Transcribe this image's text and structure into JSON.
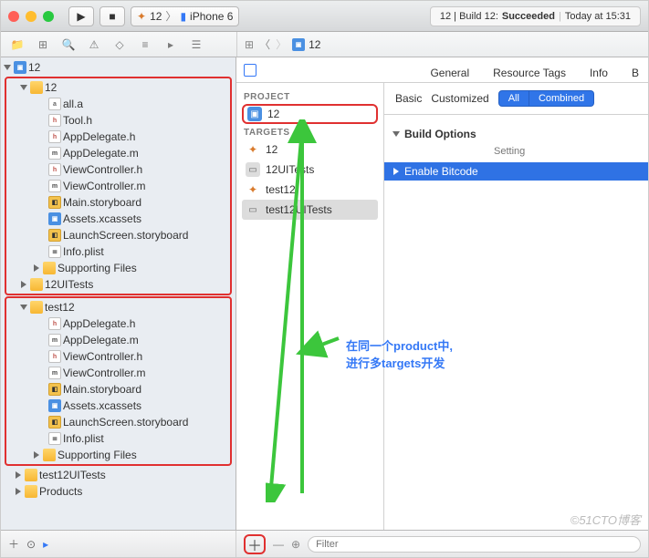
{
  "toolbar": {
    "scheme": "12",
    "device": "iPhone 6",
    "status_prefix": "12  |  Build 12: ",
    "status_word": "Succeeded",
    "status_time": "Today at 15:31"
  },
  "breadcrumb": {
    "item": "12"
  },
  "project_tree": {
    "root": "12",
    "group1": {
      "name": "12",
      "files": [
        "all.a",
        "Tool.h",
        "AppDelegate.h",
        "AppDelegate.m",
        "ViewController.h",
        "ViewController.m",
        "Main.storyboard",
        "Assets.xcassets",
        "LaunchScreen.storyboard",
        "Info.plist",
        "Supporting Files"
      ]
    },
    "group_uitests": "12UITests",
    "group2": {
      "name": "test12",
      "files": [
        "AppDelegate.h",
        "AppDelegate.m",
        "ViewController.h",
        "ViewController.m",
        "Main.storyboard",
        "Assets.xcassets",
        "LaunchScreen.storyboard",
        "Info.plist",
        "Supporting Files"
      ]
    },
    "group_test12uitests": "test12UITests",
    "group_products": "Products"
  },
  "targets_pane": {
    "project_label": "PROJECT",
    "project_name": "12",
    "targets_label": "TARGETS",
    "targets": [
      "12",
      "12UITests",
      "test12",
      "test12UITests"
    ]
  },
  "tabs": {
    "general": "General",
    "resource_tags": "Resource Tags",
    "info": "Info",
    "b": "B"
  },
  "filter": {
    "basic": "Basic",
    "customized": "Customized",
    "all": "All",
    "combined": "Combined"
  },
  "build": {
    "group": "Build Options",
    "col": "Setting",
    "row": "Enable Bitcode"
  },
  "bottom": {
    "filter_placeholder": "Filter"
  },
  "annotation": {
    "line1": "在同一个product中,",
    "line2": "进行多targets开发"
  },
  "watermark": "©51CTO博客"
}
